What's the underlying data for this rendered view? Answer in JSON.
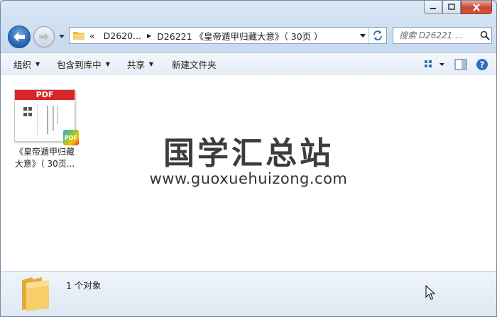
{
  "window": {
    "caption": {
      "minimize": "minimize",
      "maximize": "maximize",
      "close": "close"
    }
  },
  "nav": {
    "address": {
      "overflow": "«",
      "crumbs": [
        "D2620...",
        "D26221 《皇帝遁甲归藏大意》（ 30页 ）"
      ]
    },
    "search": {
      "placeholder": "搜索 D26221 ..."
    }
  },
  "toolbar": {
    "organize": "组织",
    "include_in_library": "包含到库中",
    "share": "共享",
    "new_folder": "新建文件夹"
  },
  "content": {
    "files": [
      {
        "type": "pdf",
        "thumb_label": "PDF",
        "badge": "PDF",
        "name": "《皇帝遁甲归藏\n大意》（ 30页..."
      }
    ],
    "watermark": {
      "title": "国学汇总站",
      "url": "www.guoxuehuizong.com"
    }
  },
  "details": {
    "count_text": "1 个对象"
  },
  "colors": {
    "accent": "#1f5fb3",
    "pdf_red": "#d7262a",
    "folder": "#f4c44a"
  }
}
